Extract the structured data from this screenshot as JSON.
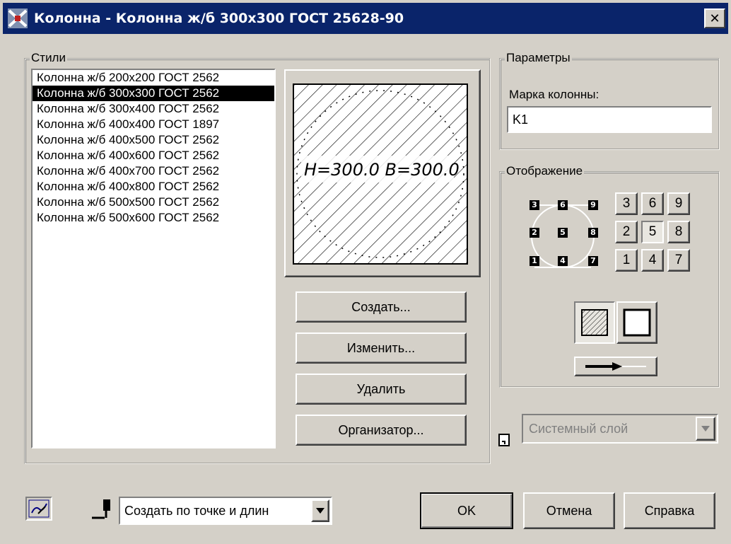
{
  "window": {
    "title": "Колонна - Колонна ж/б 300x300 ГОСТ 25628-90",
    "close_glyph": "✕"
  },
  "styles": {
    "group_label": "Стили",
    "items": [
      {
        "label": "Колонна ж/б 200x200 ГОСТ 2562",
        "selected": false
      },
      {
        "label": "Колонна ж/б 300x300 ГОСТ 2562",
        "selected": true
      },
      {
        "label": "Колонна ж/б 300x400 ГОСТ 2562",
        "selected": false
      },
      {
        "label": "Колонна ж/б 400x400 ГОСТ 1897",
        "selected": false
      },
      {
        "label": "Колонна ж/б 400x500 ГОСТ 2562",
        "selected": false
      },
      {
        "label": "Колонна ж/б 400x600 ГОСТ 2562",
        "selected": false
      },
      {
        "label": "Колонна ж/б 400x700 ГОСТ 2562",
        "selected": false
      },
      {
        "label": "Колонна ж/б 400x800 ГОСТ 2562",
        "selected": false
      },
      {
        "label": "Колонна ж/б 500x500 ГОСТ 2562",
        "selected": false
      },
      {
        "label": "Колонна ж/б 500x600 ГОСТ 2562",
        "selected": false
      }
    ],
    "preview_label": "H=300.0 B=300.0",
    "buttons": {
      "create": "Создать...",
      "edit": "Изменить...",
      "delete": "Удалить",
      "organizer": "Организатор..."
    }
  },
  "parameters": {
    "group_label": "Параметры",
    "mark_label": "Марка колонны:",
    "mark_value": "K1"
  },
  "display": {
    "group_label": "Отображение",
    "anchor_grid": [
      [
        "3",
        "6",
        "9"
      ],
      [
        "2",
        "5",
        "8"
      ],
      [
        "1",
        "4",
        "7"
      ]
    ],
    "selected_anchor": "5",
    "mini_labels": {
      "tl": "3",
      "tm": "6",
      "tr": "9",
      "ml": "2",
      "mm": "5",
      "mr": "8",
      "bl": "1",
      "bm": "4",
      "br": "7"
    }
  },
  "layer": {
    "value": "Системный слой",
    "disabled": true
  },
  "footer": {
    "method_value": "Создать по точке и длин",
    "ok": "OK",
    "cancel": "Отмена",
    "help": "Справка"
  },
  "colors": {
    "titlebar": "#0a246a",
    "face": "#d4d0c8",
    "selection": "#000000"
  }
}
